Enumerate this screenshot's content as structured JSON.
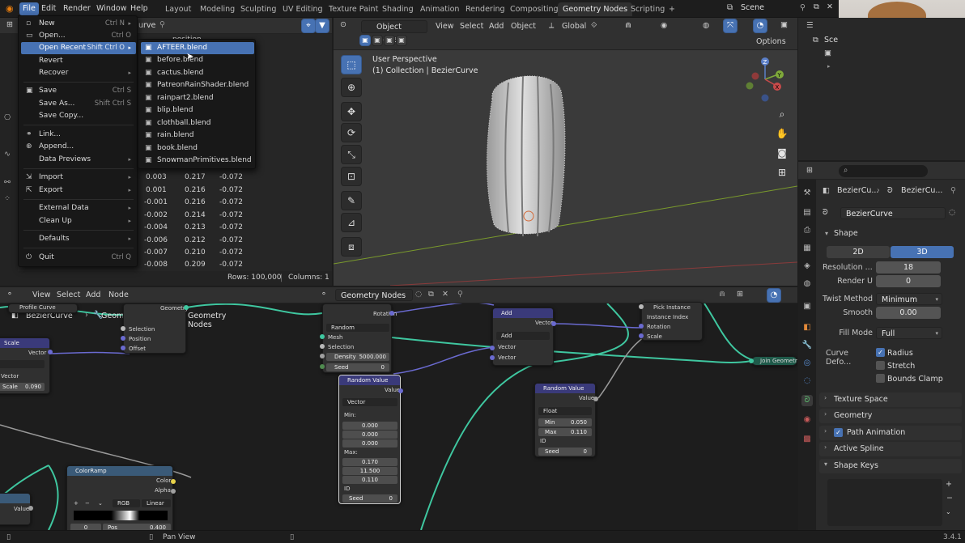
{
  "topbar": {
    "menus": [
      "File",
      "Edit",
      "Render",
      "Window",
      "Help"
    ],
    "workspaces": [
      "Layout",
      "Modeling",
      "Sculpting",
      "UV Editing",
      "Texture Paint",
      "Shading",
      "Animation",
      "Rendering",
      "Compositing",
      "Geometry Nodes",
      "Scripting"
    ],
    "active_workspace": "Geometry Nodes",
    "add_tab": "+",
    "scene": "Scene"
  },
  "file_menu": {
    "items": [
      {
        "label": "New",
        "shortcut": "Ctrl N",
        "arrow": "▸"
      },
      {
        "label": "Open...",
        "shortcut": "Ctrl O"
      },
      {
        "label": "Open Recent",
        "shortcut": "Shift Ctrl O",
        "arrow": "▸"
      },
      {
        "label": "Revert"
      },
      {
        "label": "Recover",
        "arrow": "▸"
      },
      {
        "label": "Save",
        "shortcut": "Ctrl S"
      },
      {
        "label": "Save As...",
        "shortcut": "Shift Ctrl S"
      },
      {
        "label": "Save Copy..."
      },
      {
        "label": "Link..."
      },
      {
        "label": "Append..."
      },
      {
        "label": "Data Previews",
        "arrow": "▸"
      },
      {
        "label": "Import",
        "arrow": "▸"
      },
      {
        "label": "Export",
        "arrow": "▸"
      },
      {
        "label": "External Data",
        "arrow": "▸"
      },
      {
        "label": "Clean Up",
        "arrow": "▸"
      },
      {
        "label": "Defaults",
        "arrow": "▸"
      },
      {
        "label": "Quit",
        "shortcut": "Ctrl Q"
      }
    ]
  },
  "recent_files": [
    "AFTEER.blend",
    "before.blend",
    "cactus.blend",
    "PatreonRainShader.blend",
    "rainpart2.blend",
    "blip.blend",
    "clothball.blend",
    "rain.blend",
    "book.blend",
    "SnowmanPrimitives.blend"
  ],
  "spreadsheet": {
    "header_partial": "urve",
    "column_header": "position",
    "rows": [
      [
        "0.003",
        "0.217",
        "-0.072"
      ],
      [
        "0.001",
        "0.216",
        "-0.072"
      ],
      [
        "-0.001",
        "0.216",
        "-0.072"
      ],
      [
        "-0.002",
        "0.214",
        "-0.072"
      ],
      [
        "-0.004",
        "0.213",
        "-0.072"
      ],
      [
        "-0.006",
        "0.212",
        "-0.072"
      ],
      [
        "-0.007",
        "0.210",
        "-0.072"
      ],
      [
        "-0.008",
        "0.209",
        "-0.072"
      ]
    ],
    "rows_count": "Rows: 100,000",
    "cols_count": "Columns: 1"
  },
  "viewport": {
    "mode": "Object Mode",
    "menus": [
      "View",
      "Select",
      "Add",
      "Object"
    ],
    "orientation": "Global",
    "options": "Options",
    "perspective": "User Perspective",
    "collection": "(1) Collection | BezierCurve",
    "axes": {
      "x": "X",
      "y": "Y",
      "z": "Z"
    }
  },
  "node_editor": {
    "menus": [
      "View",
      "Select",
      "Add",
      "Node"
    ],
    "tree_name": "Geometry Nodes",
    "breadcrumb": [
      "BezierCurve",
      "GeometryNodes",
      "Geometry Nodes"
    ],
    "labels": {
      "profile_curve": "Profile Curve",
      "geometry": "Geometry",
      "selection": "Selection",
      "position": "Position",
      "offset": "Offset",
      "scale": "Scale",
      "vector": "Vector",
      "scale_val": "0.090",
      "rotation": "Rotation",
      "random": "Random",
      "mesh": "Mesh",
      "density": "Density",
      "density_val": "5000.000",
      "seed": "Seed",
      "seed_val": "0",
      "add": "Add",
      "add_op": "Add",
      "pick_instance": "Pick Instance",
      "instance_index": "Instance Index",
      "join_geometry": "Join Geometry",
      "random_value": "Random Value",
      "value": "Value",
      "min": "Min:",
      "max": "Max:",
      "min_vals": [
        "0.000",
        "0.000",
        "0.000"
      ],
      "max_vals": [
        "0.170",
        "11.500",
        "0.110"
      ],
      "id": "ID",
      "float": "Float",
      "rv2_min": "Min",
      "rv2_min_val": "0.050",
      "rv2_max": "Max",
      "rv2_max_val": "0.110",
      "color_ramp": "ColorRamp",
      "color": "Color",
      "alpha": "Alpha",
      "rgb": "RGB",
      "linear": "Linear",
      "cr_vals": [
        "0",
        "Pos",
        "0.400"
      ]
    }
  },
  "outliner": {
    "scene_partial": "Sce"
  },
  "properties": {
    "crumb1": "BezierCu...",
    "crumb2": "BezierCu...",
    "object_name": "BezierCurve",
    "shape_panel": "Shape",
    "d2": "2D",
    "d3": "3D",
    "resolution_label": "Resolution ...",
    "resolution": "18",
    "render_u_label": "Render U",
    "render_u": "0",
    "twist_label": "Twist Method",
    "twist": "Minimum",
    "smooth_label": "Smooth",
    "smooth": "0.00",
    "fill_label": "Fill Mode",
    "fill": "Full",
    "deform_label": "Curve Defo...",
    "radius": "Radius",
    "stretch": "Stretch",
    "bounds": "Bounds Clamp",
    "panels": [
      "Texture Space",
      "Geometry",
      "Path Animation",
      "Active Spline",
      "Shape Keys"
    ]
  },
  "status": {
    "action": "Pan View",
    "version": "3.4.1"
  }
}
